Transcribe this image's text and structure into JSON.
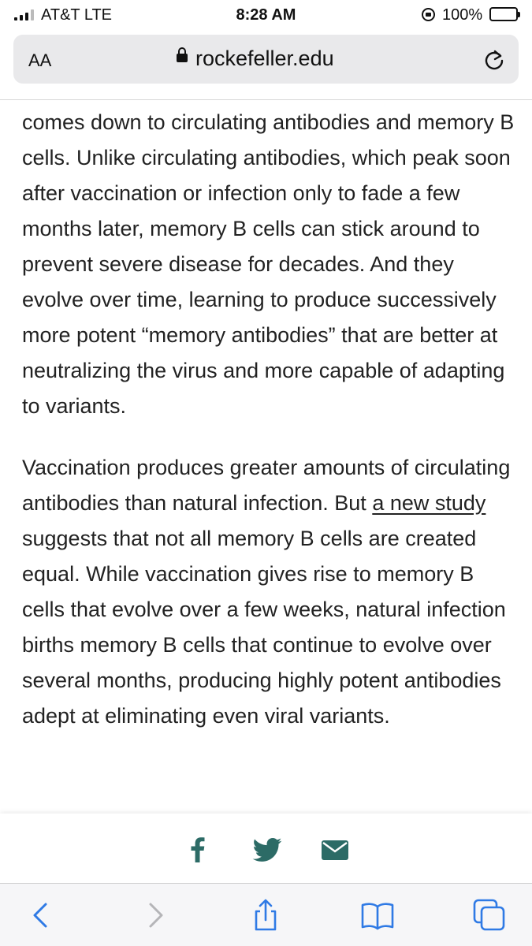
{
  "status_bar": {
    "carrier": "AT&T  LTE",
    "time": "8:28 AM",
    "battery_percent": "100%",
    "battery_level": 1.0,
    "battery_color": "#f7c948"
  },
  "address_bar": {
    "reader_label": "AA",
    "url": "rockefeller.edu",
    "lock_icon": "padlock-icon",
    "reload_icon": "reload-icon"
  },
  "article": {
    "para1": "comes down to circulating antibodies and memory B cells. Unlike circulating antibodies, which peak soon after vaccination or infection only to fade a few months later, memory B cells can stick around to prevent severe disease for decades. And they evolve over time, learning to produce successively more potent “memory antibodies” that are better at neutralizing the virus and more capable of adapting to variants.",
    "para2_before_link": "Vaccination produces greater amounts of circulating antibodies than natural infection. But ",
    "para2_link": "a new study",
    "para2_after_link": " suggests that not all memory B cells are created equal. While vaccination gives rise to memory B cells that evolve over a few weeks, natural infection births memory B cells that continue to evolve over several months, producing highly potent antibodies adept at eliminating even viral variants."
  },
  "share_bar": {
    "icons": [
      "facebook-icon",
      "twitter-icon",
      "email-icon"
    ],
    "color": "#2c6b66"
  },
  "toolbar": {
    "icons": [
      "back-icon",
      "forward-icon",
      "share-icon",
      "bookmarks-icon",
      "tabs-icon"
    ],
    "active_color": "#2f7ae5",
    "disabled_color": "#b5b5b8"
  }
}
